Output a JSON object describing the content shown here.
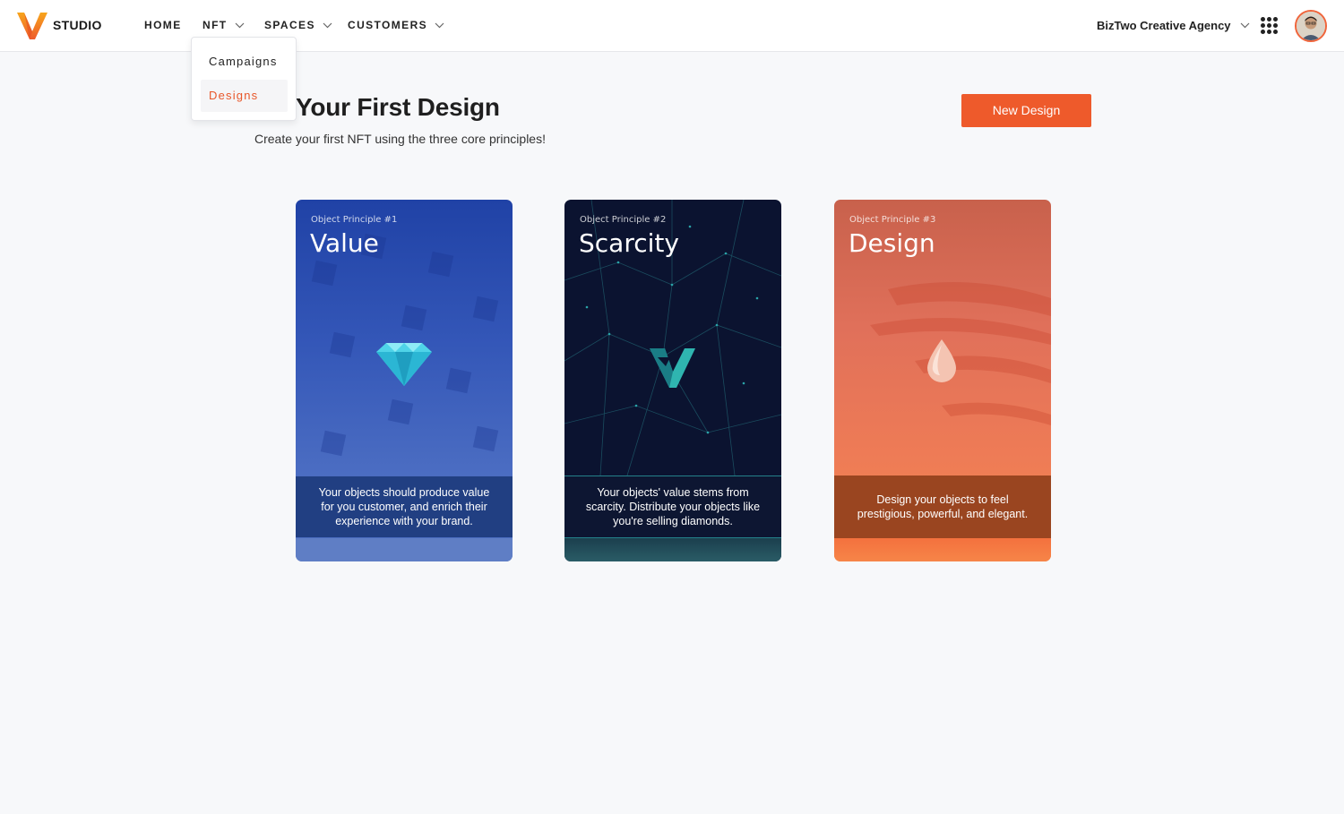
{
  "brand": {
    "name": "STUDIO",
    "accent": "#ee5a2b"
  },
  "nav": {
    "home": "HOME",
    "nft": "NFT",
    "spaces": "SPACES",
    "customers": "CUSTOMERS"
  },
  "dropdown": {
    "items": [
      {
        "label": "Campaigns",
        "active": false
      },
      {
        "label": "Designs",
        "active": true
      }
    ]
  },
  "account": {
    "org": "BizTwo Creative Agency"
  },
  "page": {
    "title": "ate Your First Design",
    "subtitle": "Create your first NFT using the three core principles!",
    "new_button": "New Design"
  },
  "cards": [
    {
      "kicker": "Object Principle #1",
      "title": "Value",
      "description": "Your objects should produce value for you customer, and enrich their experience with your brand.",
      "icon": "diamond-icon"
    },
    {
      "kicker": "Object Principle #2",
      "title": "Scarcity",
      "description": "Your objects' value stems from scarcity. Distribute your objects like you're selling diamonds.",
      "icon": "v-logo-icon"
    },
    {
      "kicker": "Object Principle #3",
      "title": "Design",
      "description": "Design your objects to feel prestigious, powerful, and elegant.",
      "icon": "droplet-icon"
    }
  ]
}
